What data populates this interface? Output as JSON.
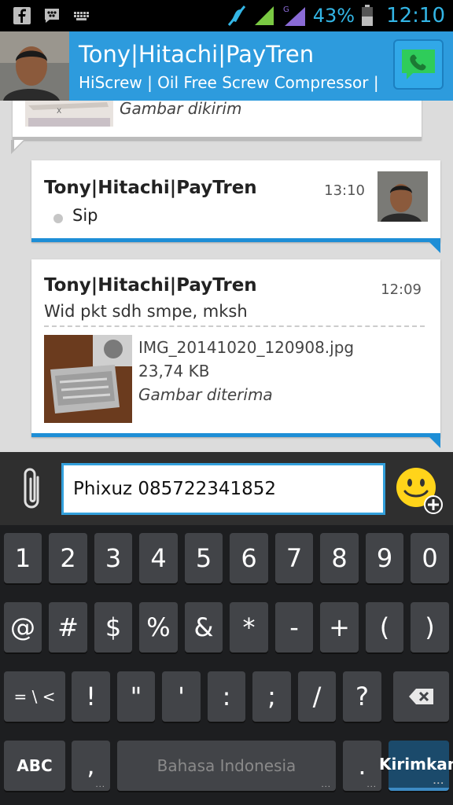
{
  "status_bar": {
    "icons": [
      "facebook-icon",
      "bbm-icon",
      "keyboard-icon",
      "mute-icon",
      "signal-icon",
      "signal-g-icon",
      "battery-icon"
    ],
    "battery_percent": "43%",
    "time": "12:10"
  },
  "header": {
    "title": "Tony|Hitachi|PayTren",
    "subtitle": "HiScrew | Oil Free Screw Compressor |..."
  },
  "chat": {
    "prev_message": {
      "status": "Gambar dikirim"
    },
    "message_sip": {
      "sender": "Tony|Hitachi|PayTren",
      "time": "13:10",
      "text": "Sip"
    },
    "message_received": {
      "sender": "Tony|Hitachi|PayTren",
      "time": "12:09",
      "text": "Wid pkt sdh smpe, mksh",
      "attachment": {
        "file_name": "IMG_20141020_120908.jpg",
        "file_size": "23,74 KB",
        "status": "Gambar diterima"
      }
    }
  },
  "compose": {
    "value": "Phixuz 085722341852"
  },
  "keyboard": {
    "row1": [
      "1",
      "2",
      "3",
      "4",
      "5",
      "6",
      "7",
      "8",
      "9",
      "0"
    ],
    "row2": [
      "@",
      "#",
      "$",
      "%",
      "&",
      "*",
      "-",
      "+",
      "(",
      ")"
    ],
    "row3": [
      "= \\ <",
      "!",
      "\"",
      "'",
      ":",
      ";",
      "/",
      "?"
    ],
    "row4": {
      "abc": "ABC",
      "comma": ",",
      "space": "Bahasa Indonesia",
      "period": ".",
      "send": "Kirimkan"
    }
  },
  "colors": {
    "accent": "#2d9bdd",
    "bubble_border": "#1e8ed6",
    "chat_bg": "#dcdcdc",
    "keyboard_bg": "#1d1e20"
  }
}
